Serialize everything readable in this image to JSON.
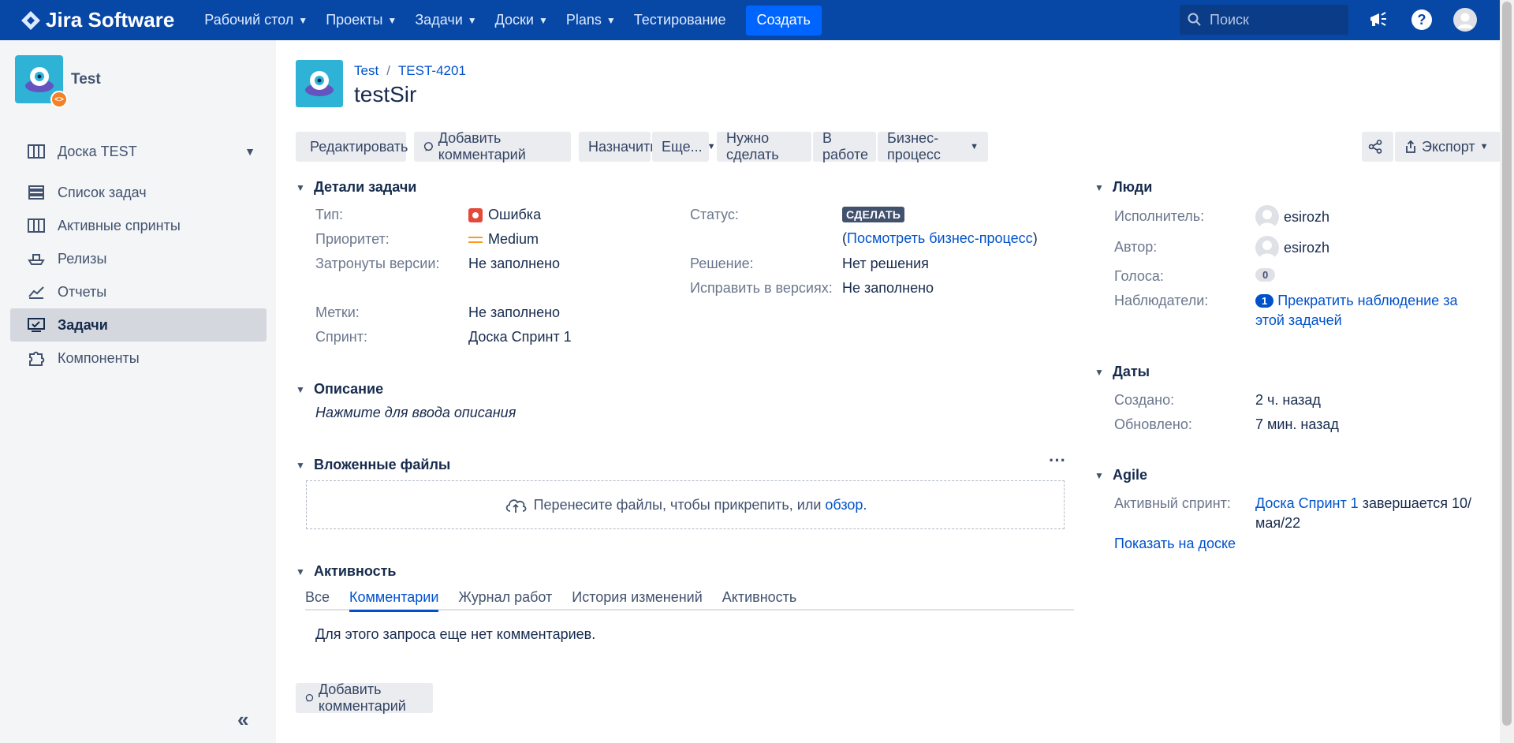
{
  "topbar": {
    "logo_text": "Jira Software",
    "nav": [
      {
        "label": "Рабочий стол",
        "chevron": true
      },
      {
        "label": "Проекты",
        "chevron": true
      },
      {
        "label": "Задачи",
        "chevron": true
      },
      {
        "label": "Доски",
        "chevron": true
      },
      {
        "label": "Plans",
        "chevron": true
      },
      {
        "label": "Тестирование",
        "chevron": false
      }
    ],
    "create_label": "Создать",
    "search_placeholder": "Поиск",
    "icons": [
      "megaphone-icon",
      "help-icon",
      "profile-avatar"
    ]
  },
  "sidebar": {
    "project_name": "Test",
    "board_label": "Доска TEST",
    "items": [
      {
        "label": "Список задач",
        "icon": "backlog-icon"
      },
      {
        "label": "Активные спринты",
        "icon": "board-icon"
      },
      {
        "label": "Релизы",
        "icon": "ship-icon"
      },
      {
        "label": "Отчеты",
        "icon": "chart-icon"
      },
      {
        "label": "Задачи",
        "icon": "issues-icon",
        "active": true
      },
      {
        "label": "Компоненты",
        "icon": "puzzle-icon"
      }
    ]
  },
  "issue": {
    "breadcrumb_project": "Test",
    "breadcrumb_key": "TEST-4201",
    "title": "testSir"
  },
  "toolbar": {
    "edit": "Редактировать",
    "comment": "Добавить комментарий",
    "assign": "Назначить",
    "more": "Еще...",
    "todo": "Нужно сделать",
    "in_progress": "В работе",
    "workflow": "Бизнес-процесс",
    "export": "Экспорт"
  },
  "details": {
    "heading": "Детали задачи",
    "type_label": "Тип:",
    "type_value": "Ошибка",
    "priority_label": "Приоритет:",
    "priority_value": "Medium",
    "affects_label": "Затронуты версии:",
    "affects_value": "Не заполнено",
    "labels_label": "Метки:",
    "labels_value": "Не заполнено",
    "sprint_label": "Спринт:",
    "sprint_value": "Доска Спринт 1",
    "status_label": "Статус:",
    "status_value": "СДЕЛАТЬ",
    "workflow_open": "(",
    "workflow_link": "Посмотреть бизнес-процесс",
    "workflow_close": ")",
    "resolution_label": "Решение:",
    "resolution_value": "Нет решения",
    "fix_label": "Исправить в версиях:",
    "fix_value": "Не заполнено"
  },
  "description": {
    "heading": "Описание",
    "placeholder": "Нажмите для ввода описания"
  },
  "attachments": {
    "heading": "Вложенные файлы",
    "drop_text": "Перенесите файлы, чтобы прикрепить, или ",
    "browse_link": "обзор."
  },
  "activity": {
    "heading": "Активность",
    "tabs": [
      "Все",
      "Комментарии",
      "Журнал работ",
      "История изменений",
      "Активность"
    ],
    "active_tab": "Комментарии",
    "empty_text": "Для этого запроса еще нет комментариев.",
    "add_comment": "Добавить комментарий"
  },
  "people": {
    "heading": "Люди",
    "assignee_label": "Исполнитель:",
    "assignee_value": "esirozh",
    "reporter_label": "Автор:",
    "reporter_value": "esirozh",
    "votes_label": "Голоса:",
    "votes_value": "0",
    "watchers_label": "Наблюдатели:",
    "watchers_count": "1",
    "watch_link_1": "Прекратить наблюдение за",
    "watch_link_2": "этой задачей"
  },
  "dates": {
    "heading": "Даты",
    "created_label": "Создано:",
    "created_value": "2 ч. назад",
    "updated_label": "Обновлено:",
    "updated_value": "7 мин. назад"
  },
  "agile": {
    "heading": "Agile",
    "sprint_label": "Активный спринт:",
    "sprint_link": "Доска Спринт 1",
    "sprint_ends_1": " завершается 10/",
    "sprint_ends_2": "мая/22",
    "board_link": "Показать на доске"
  },
  "colors": {
    "nav_bg": "#0747a6",
    "create_bg": "#0065ff",
    "link": "#0052cc",
    "sidebar_bg": "#f4f5f7",
    "bug_red": "#e5493a",
    "priority_orange": "#ff991f"
  }
}
